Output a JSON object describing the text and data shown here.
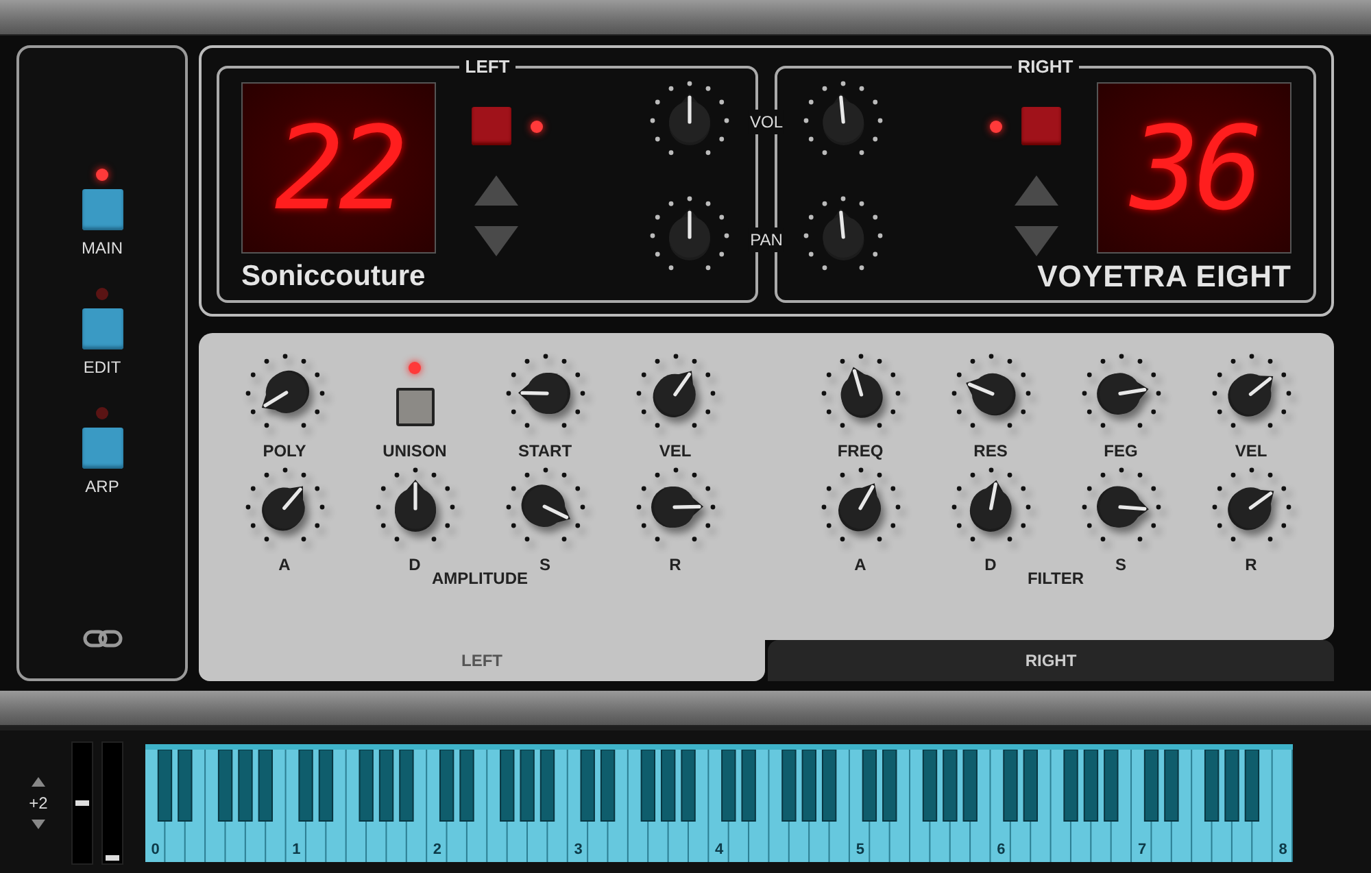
{
  "side_panel": {
    "buttons": [
      {
        "label": "MAIN",
        "led_on": true
      },
      {
        "label": "EDIT",
        "led_on": false
      },
      {
        "label": "ARP",
        "led_on": false
      }
    ]
  },
  "channels": [
    {
      "title": "LEFT",
      "display": "22",
      "brand": "Soniccouture",
      "power_led_on": true
    },
    {
      "title": "RIGHT",
      "display": "36",
      "brand": "VOYETRA EIGHT",
      "power_led_on": true
    }
  ],
  "mixer_labels": [
    "VOL",
    "PAN"
  ],
  "sections": [
    {
      "title": "AMPLITUDE",
      "controls": [
        {
          "kind": "knob",
          "label": "POLY"
        },
        {
          "kind": "toggle",
          "label": "UNISON",
          "led_on": true
        },
        {
          "kind": "knob",
          "label": "START"
        },
        {
          "kind": "knob",
          "label": "VEL"
        },
        {
          "kind": "knob",
          "label": "A"
        },
        {
          "kind": "knob",
          "label": "D"
        },
        {
          "kind": "knob",
          "label": "S"
        },
        {
          "kind": "knob",
          "label": "R"
        }
      ]
    },
    {
      "title": "FILTER",
      "controls": [
        {
          "kind": "knob",
          "label": "FREQ"
        },
        {
          "kind": "knob",
          "label": "RES"
        },
        {
          "kind": "knob",
          "label": "FEG"
        },
        {
          "kind": "knob",
          "label": "VEL"
        },
        {
          "kind": "knob",
          "label": "A"
        },
        {
          "kind": "knob",
          "label": "D"
        },
        {
          "kind": "knob",
          "label": "S"
        },
        {
          "kind": "knob",
          "label": "R"
        }
      ]
    }
  ],
  "tabs": [
    {
      "label": "LEFT",
      "selected": true
    },
    {
      "label": "RIGHT",
      "selected": false
    }
  ],
  "keyboard": {
    "transpose": "+2",
    "wheels": [
      {
        "level": 0.5
      },
      {
        "level": 0
      }
    ],
    "octave_labels": [
      "0",
      "1",
      "2",
      "3",
      "4",
      "5",
      "6",
      "7",
      "8"
    ]
  }
}
